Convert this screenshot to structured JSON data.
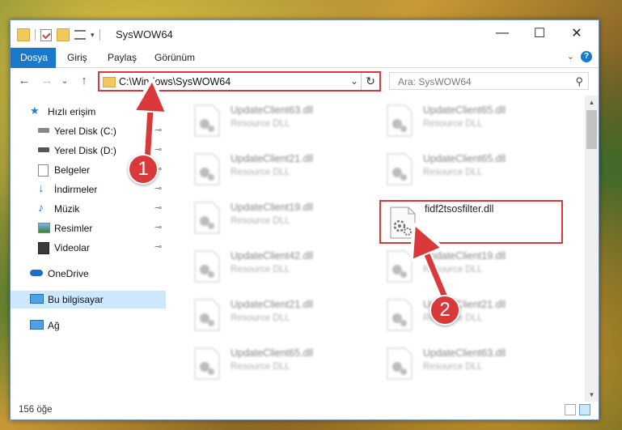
{
  "window": {
    "title": "SysWOW64",
    "controls": {
      "minimize": "—",
      "maximize": "☐",
      "close": "✕"
    }
  },
  "ribbon": {
    "tabs": [
      {
        "label": "Dosya",
        "active": true
      },
      {
        "label": "Giriş"
      },
      {
        "label": "Paylaş"
      },
      {
        "label": "Görünüm"
      }
    ],
    "help": "?"
  },
  "navigation": {
    "back": "←",
    "forward": "→",
    "recent": "⌄",
    "up": "↑",
    "address": "C:\\Windows\\SysWOW64",
    "address_dropdown": "⌄",
    "refresh": "↻",
    "search_placeholder": "Ara: SysWOW64",
    "search_icon": "search-icon"
  },
  "sidebar": {
    "items": [
      {
        "label": "Hızlı erişim",
        "icon": "star-icon"
      },
      {
        "label": "Yerel Disk (C:)",
        "icon": "drive-icon",
        "pinned": true
      },
      {
        "label": "Yerel Disk (D:)",
        "icon": "drive-icon",
        "pinned": true
      },
      {
        "label": "Belgeler",
        "icon": "documents-icon",
        "pinned": true
      },
      {
        "label": "İndirmeler",
        "icon": "download-icon",
        "pinned": true
      },
      {
        "label": "Müzik",
        "icon": "music-icon",
        "pinned": true
      },
      {
        "label": "Resimler",
        "icon": "pictures-icon",
        "pinned": true
      },
      {
        "label": "Videolar",
        "icon": "videos-icon",
        "pinned": true
      },
      {
        "label": "OneDrive",
        "icon": "cloud-icon"
      },
      {
        "label": "Bu bilgisayar",
        "icon": "computer-icon",
        "selected": true
      },
      {
        "label": "Ağ",
        "icon": "network-icon"
      }
    ],
    "pin_glyph": "📌"
  },
  "files": [
    {
      "name": "UpdateClient63.dll",
      "type": "Resource DLL"
    },
    {
      "name": "UpdateClient65.dll",
      "type": "Resource DLL"
    },
    {
      "name": "UpdateClient21.dll",
      "type": "Resource DLL"
    },
    {
      "name": "UpdateClient65.dll",
      "type": "Resource DLL"
    },
    {
      "name": "UpdateClient19.dll",
      "type": "Resource DLL"
    },
    {
      "name": "fidf2tsosfilter.dll",
      "type": "",
      "highlighted": true
    },
    {
      "name": "UpdateClient42.dll",
      "type": "Resource DLL"
    },
    {
      "name": "UpdateClient19.dll",
      "type": "Resource DLL"
    },
    {
      "name": "UpdateClient21.dll",
      "type": "Resource DLL"
    },
    {
      "name": "UpdateClient21.dll",
      "type": "Resource DLL"
    },
    {
      "name": "UpdateClient65.dll",
      "type": "Resource DLL"
    },
    {
      "name": "UpdateClient63.dll",
      "type": "Resource DLL"
    }
  ],
  "status": {
    "count": "156 öğe"
  },
  "callouts": [
    {
      "number": "1"
    },
    {
      "number": "2"
    }
  ],
  "colors": {
    "accent": "#1979ca",
    "highlight": "#d9393b",
    "selected": "#cce8ff"
  }
}
